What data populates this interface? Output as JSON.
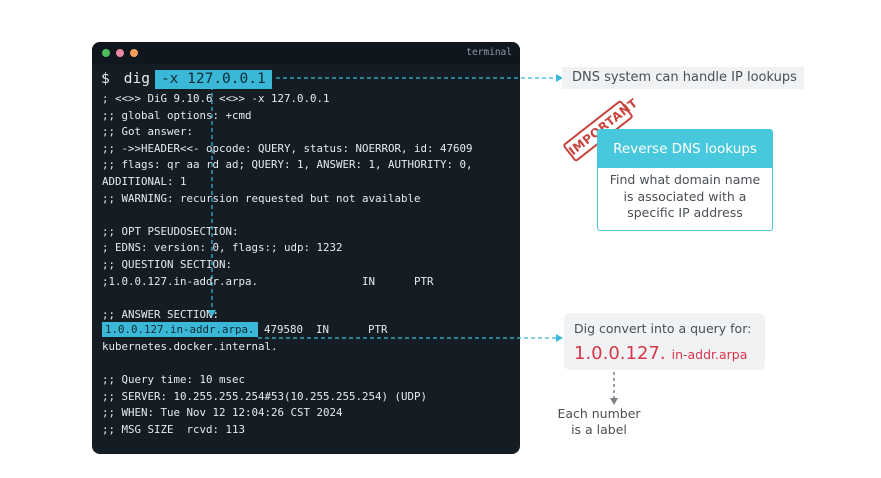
{
  "terminal": {
    "title": "terminal",
    "prompt_symbol": "$",
    "command": "dig",
    "command_args": "-x 127.0.0.1",
    "output_lines": [
      "; <<>> DiG 9.10.6 <<>> -x 127.0.0.1",
      ";; global options: +cmd",
      ";; Got answer:",
      ";; ->>HEADER<<- opcode: QUERY, status: NOERROR, id: 47609",
      ";; flags: qr aa rd ad; QUERY: 1, ANSWER: 1, AUTHORITY: 0,",
      "ADDITIONAL: 1",
      ";; WARNING: recursion requested but not available",
      "",
      ";; OPT PSEUDOSECTION:",
      "; EDNS: version: 0, flags:; udp: 1232",
      ";; QUESTION SECTION:",
      ";1.0.0.127.in-addr.arpa.                IN      PTR",
      "",
      ";; ANSWER SECTION:"
    ],
    "answer_name": "1.0.0.127.in-addr.arpa.",
    "answer_rest": " 479580  IN      PTR",
    "output_lines_2": [
      "kubernetes.docker.internal.",
      "",
      ";; Query time: 10 msec",
      ";; SERVER: 10.255.255.254#53(10.255.255.254) (UDP)",
      ";; WHEN: Tue Nov 12 12:04:26 CST 2024",
      ";; MSG SIZE  rcvd: 113"
    ]
  },
  "annotations": {
    "ip_lookup": "DNS system can handle IP lookups",
    "stamp": "IMPORTANT",
    "reverse_title": "Reverse DNS lookups",
    "reverse_desc": "Find what domain name is associated with a specific IP address",
    "query_label": "Dig convert into a query for:",
    "query_ip": "1.0.0.127.",
    "query_suffix": "in-addr.arpa",
    "label_note": "Each number is a label"
  },
  "colors": {
    "terminal_bg": "#141c24",
    "highlight": "#3bb8d8",
    "accent_red": "#d8364a",
    "card_teal": "#48c8dc",
    "stamp_red": "#c8453d"
  }
}
